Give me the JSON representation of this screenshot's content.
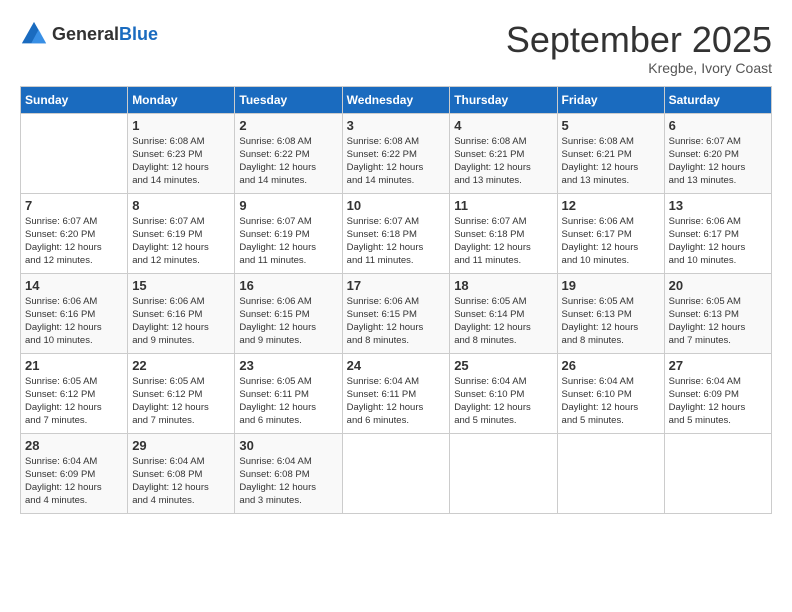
{
  "logo": {
    "text_general": "General",
    "text_blue": "Blue"
  },
  "title": "September 2025",
  "subtitle": "Kregbe, Ivory Coast",
  "days_header": [
    "Sunday",
    "Monday",
    "Tuesday",
    "Wednesday",
    "Thursday",
    "Friday",
    "Saturday"
  ],
  "weeks": [
    [
      {
        "day": "",
        "info": ""
      },
      {
        "day": "1",
        "info": "Sunrise: 6:08 AM\nSunset: 6:23 PM\nDaylight: 12 hours\nand 14 minutes."
      },
      {
        "day": "2",
        "info": "Sunrise: 6:08 AM\nSunset: 6:22 PM\nDaylight: 12 hours\nand 14 minutes."
      },
      {
        "day": "3",
        "info": "Sunrise: 6:08 AM\nSunset: 6:22 PM\nDaylight: 12 hours\nand 14 minutes."
      },
      {
        "day": "4",
        "info": "Sunrise: 6:08 AM\nSunset: 6:21 PM\nDaylight: 12 hours\nand 13 minutes."
      },
      {
        "day": "5",
        "info": "Sunrise: 6:08 AM\nSunset: 6:21 PM\nDaylight: 12 hours\nand 13 minutes."
      },
      {
        "day": "6",
        "info": "Sunrise: 6:07 AM\nSunset: 6:20 PM\nDaylight: 12 hours\nand 13 minutes."
      }
    ],
    [
      {
        "day": "7",
        "info": "Sunrise: 6:07 AM\nSunset: 6:20 PM\nDaylight: 12 hours\nand 12 minutes."
      },
      {
        "day": "8",
        "info": "Sunrise: 6:07 AM\nSunset: 6:19 PM\nDaylight: 12 hours\nand 12 minutes."
      },
      {
        "day": "9",
        "info": "Sunrise: 6:07 AM\nSunset: 6:19 PM\nDaylight: 12 hours\nand 11 minutes."
      },
      {
        "day": "10",
        "info": "Sunrise: 6:07 AM\nSunset: 6:18 PM\nDaylight: 12 hours\nand 11 minutes."
      },
      {
        "day": "11",
        "info": "Sunrise: 6:07 AM\nSunset: 6:18 PM\nDaylight: 12 hours\nand 11 minutes."
      },
      {
        "day": "12",
        "info": "Sunrise: 6:06 AM\nSunset: 6:17 PM\nDaylight: 12 hours\nand 10 minutes."
      },
      {
        "day": "13",
        "info": "Sunrise: 6:06 AM\nSunset: 6:17 PM\nDaylight: 12 hours\nand 10 minutes."
      }
    ],
    [
      {
        "day": "14",
        "info": "Sunrise: 6:06 AM\nSunset: 6:16 PM\nDaylight: 12 hours\nand 10 minutes."
      },
      {
        "day": "15",
        "info": "Sunrise: 6:06 AM\nSunset: 6:16 PM\nDaylight: 12 hours\nand 9 minutes."
      },
      {
        "day": "16",
        "info": "Sunrise: 6:06 AM\nSunset: 6:15 PM\nDaylight: 12 hours\nand 9 minutes."
      },
      {
        "day": "17",
        "info": "Sunrise: 6:06 AM\nSunset: 6:15 PM\nDaylight: 12 hours\nand 8 minutes."
      },
      {
        "day": "18",
        "info": "Sunrise: 6:05 AM\nSunset: 6:14 PM\nDaylight: 12 hours\nand 8 minutes."
      },
      {
        "day": "19",
        "info": "Sunrise: 6:05 AM\nSunset: 6:13 PM\nDaylight: 12 hours\nand 8 minutes."
      },
      {
        "day": "20",
        "info": "Sunrise: 6:05 AM\nSunset: 6:13 PM\nDaylight: 12 hours\nand 7 minutes."
      }
    ],
    [
      {
        "day": "21",
        "info": "Sunrise: 6:05 AM\nSunset: 6:12 PM\nDaylight: 12 hours\nand 7 minutes."
      },
      {
        "day": "22",
        "info": "Sunrise: 6:05 AM\nSunset: 6:12 PM\nDaylight: 12 hours\nand 7 minutes."
      },
      {
        "day": "23",
        "info": "Sunrise: 6:05 AM\nSunset: 6:11 PM\nDaylight: 12 hours\nand 6 minutes."
      },
      {
        "day": "24",
        "info": "Sunrise: 6:04 AM\nSunset: 6:11 PM\nDaylight: 12 hours\nand 6 minutes."
      },
      {
        "day": "25",
        "info": "Sunrise: 6:04 AM\nSunset: 6:10 PM\nDaylight: 12 hours\nand 5 minutes."
      },
      {
        "day": "26",
        "info": "Sunrise: 6:04 AM\nSunset: 6:10 PM\nDaylight: 12 hours\nand 5 minutes."
      },
      {
        "day": "27",
        "info": "Sunrise: 6:04 AM\nSunset: 6:09 PM\nDaylight: 12 hours\nand 5 minutes."
      }
    ],
    [
      {
        "day": "28",
        "info": "Sunrise: 6:04 AM\nSunset: 6:09 PM\nDaylight: 12 hours\nand 4 minutes."
      },
      {
        "day": "29",
        "info": "Sunrise: 6:04 AM\nSunset: 6:08 PM\nDaylight: 12 hours\nand 4 minutes."
      },
      {
        "day": "30",
        "info": "Sunrise: 6:04 AM\nSunset: 6:08 PM\nDaylight: 12 hours\nand 3 minutes."
      },
      {
        "day": "",
        "info": ""
      },
      {
        "day": "",
        "info": ""
      },
      {
        "day": "",
        "info": ""
      },
      {
        "day": "",
        "info": ""
      }
    ]
  ]
}
